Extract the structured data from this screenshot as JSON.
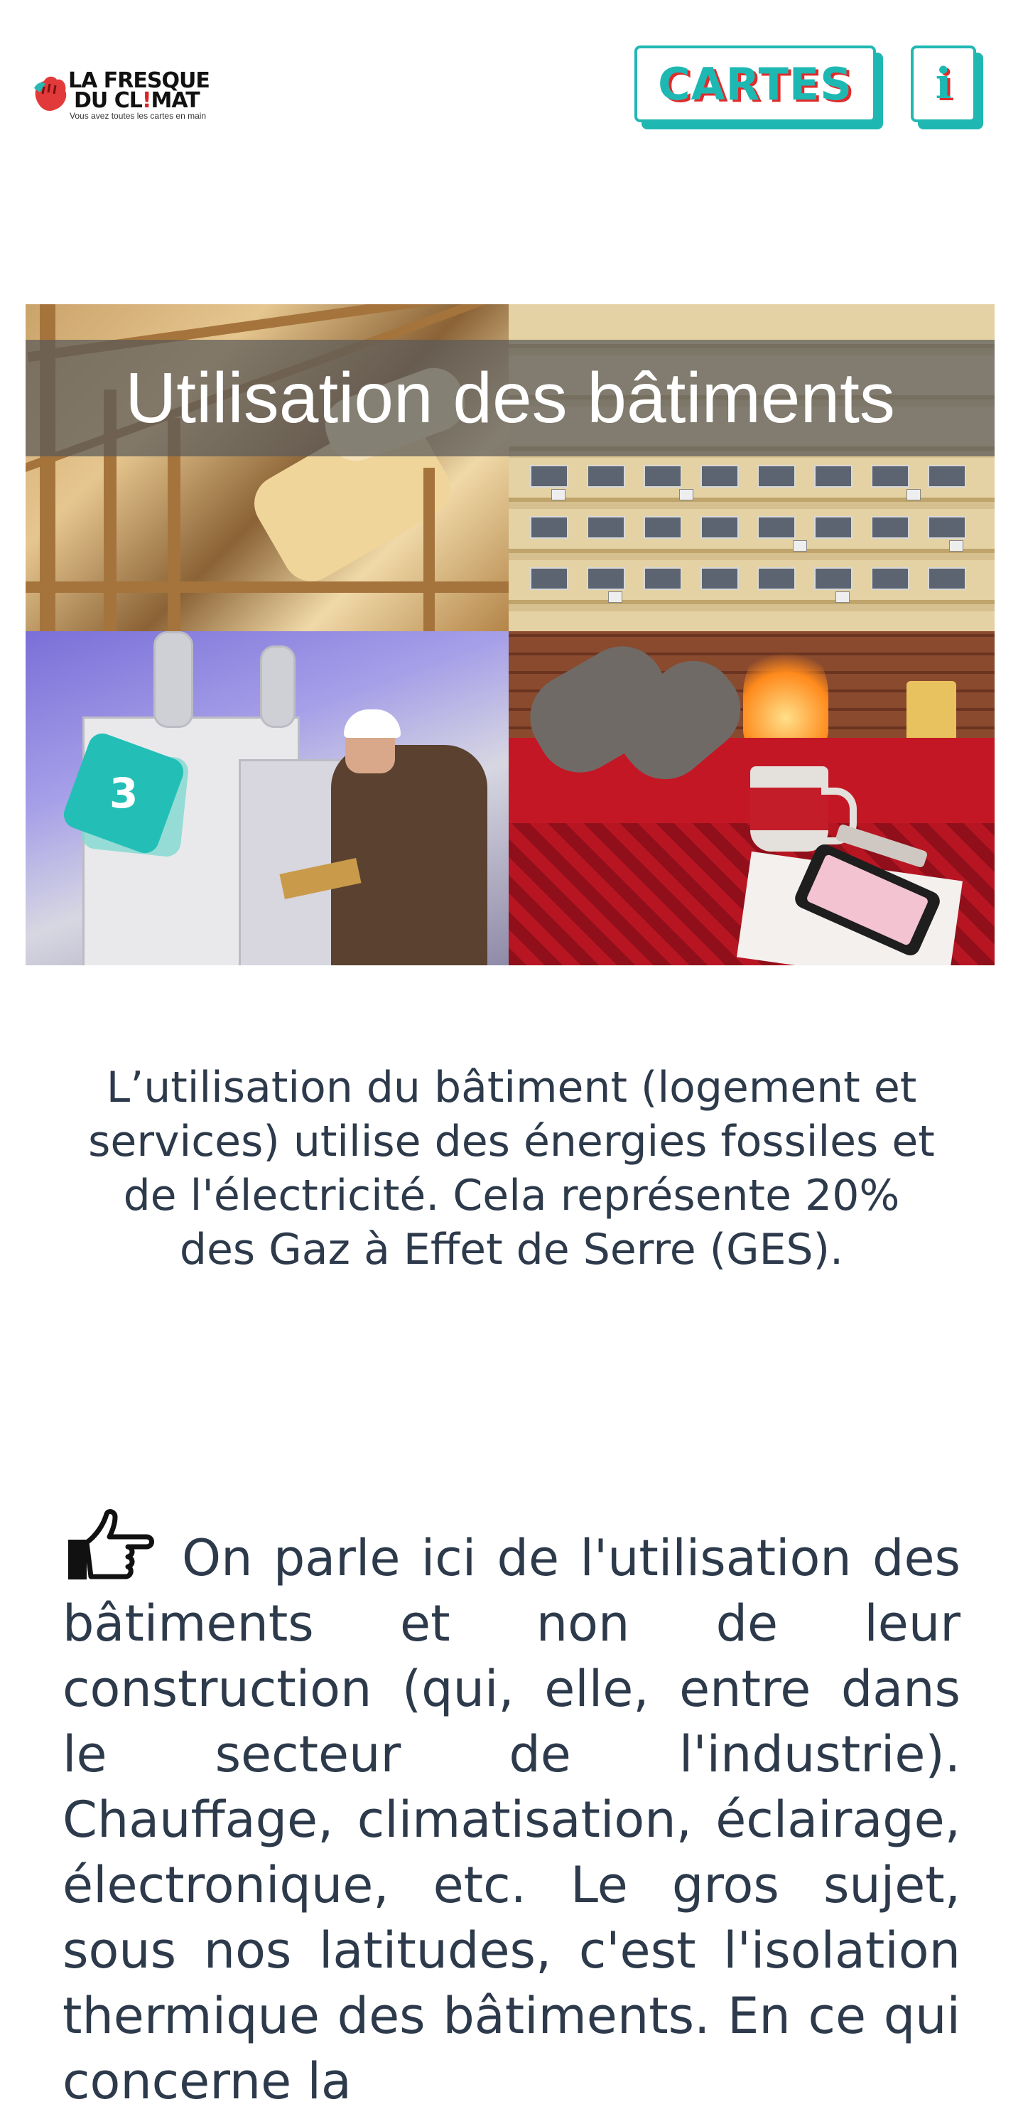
{
  "header": {
    "logo": {
      "line1": "LA FRESQUE",
      "line2_prefix": "DU CL",
      "line2_accent": "!",
      "line2_suffix": "MAT",
      "tagline": "Vous avez toutes les cartes en main",
      "icon": "hand-logo-icon"
    },
    "cartes_button_label": "CARTES",
    "info_button_label": "i"
  },
  "card": {
    "title": "Utilisation des bâtiments",
    "number": "3",
    "accent_color": "#1fb7b2"
  },
  "description": "L’utilisation du bâtiment (logement et services) utilise des énergies fossiles et de l'électricité. Cela représente 20% des Gaz à Effet de Serre (GES).",
  "note": {
    "icon": "pointing-hand-icon",
    "text": "On parle ici de l'utilisation des bâtiments et non de leur construction (qui, elle, entre dans le secteur de l'industrie). Chauffage, climatisation, éclairage, électronique, etc. Le gros sujet, sous nos latitudes, c'est l'isolation thermique des bâtiments. En ce qui concerne la"
  },
  "colors": {
    "teal": "#1fb7b2",
    "red": "#e02b2b",
    "text": "#2d3a4b"
  }
}
